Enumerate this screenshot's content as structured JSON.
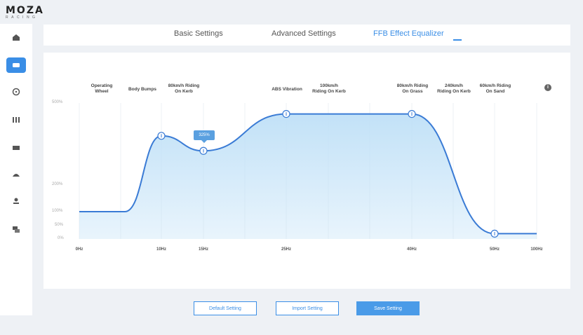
{
  "brand": {
    "name": "MOZA",
    "sub": "RACING"
  },
  "sidebar": {
    "items": [
      {
        "icon": "home-icon"
      },
      {
        "icon": "wheelbase-icon",
        "active": true
      },
      {
        "icon": "steering-wheel-icon"
      },
      {
        "icon": "pedals-icon"
      },
      {
        "icon": "dashboard-icon"
      },
      {
        "icon": "handbrake-icon"
      },
      {
        "icon": "shifter-icon"
      },
      {
        "icon": "hub-icon"
      }
    ]
  },
  "tabs": [
    {
      "label": "Basic Settings"
    },
    {
      "label": "Advanced Settings"
    },
    {
      "label": "FFB Effect Equalizer",
      "active": true
    }
  ],
  "band_labels": [
    {
      "line1": "Operating",
      "line2": "Wheel"
    },
    {
      "line1": "Body Bumps",
      "line2": ""
    },
    {
      "line1": "80km/h Riding",
      "line2": "On Kerb"
    },
    {
      "line1": "ABS Vibration",
      "line2": ""
    },
    {
      "line1": "100km/h",
      "line2": "Riding On Kerb"
    },
    {
      "line1": "80km/h Riding",
      "line2": "On Grass"
    },
    {
      "line1": "240km/h",
      "line2": "Riding On Kerb"
    },
    {
      "line1": "60km/h Riding",
      "line2": "On Sand"
    }
  ],
  "info_icon": "i",
  "chart_data": {
    "type": "area",
    "x_ticks": [
      "0Hz",
      "10Hz",
      "15Hz",
      "25Hz",
      "40Hz",
      "50Hz",
      "100Hz"
    ],
    "y_ticks": [
      "500%",
      "200%",
      "100%",
      "50%",
      "0%"
    ],
    "ylim": [
      0,
      500
    ],
    "points": [
      {
        "x": "0Hz",
        "y": 100
      },
      {
        "x": "10Hz",
        "y": 380
      },
      {
        "x": "15Hz",
        "y": 325,
        "tooltip": "325%"
      },
      {
        "x": "25Hz",
        "y": 460
      },
      {
        "x": "40Hz",
        "y": 460
      },
      {
        "x": "50Hz",
        "y": 20
      },
      {
        "x": "100Hz",
        "y": 20
      }
    ],
    "line_color": "#3a7bd5",
    "fill_color": "#bfe0f7",
    "grid": true
  },
  "buttons": {
    "default": "Default Setting",
    "import": "Import Setting",
    "save": "Save Setting"
  }
}
